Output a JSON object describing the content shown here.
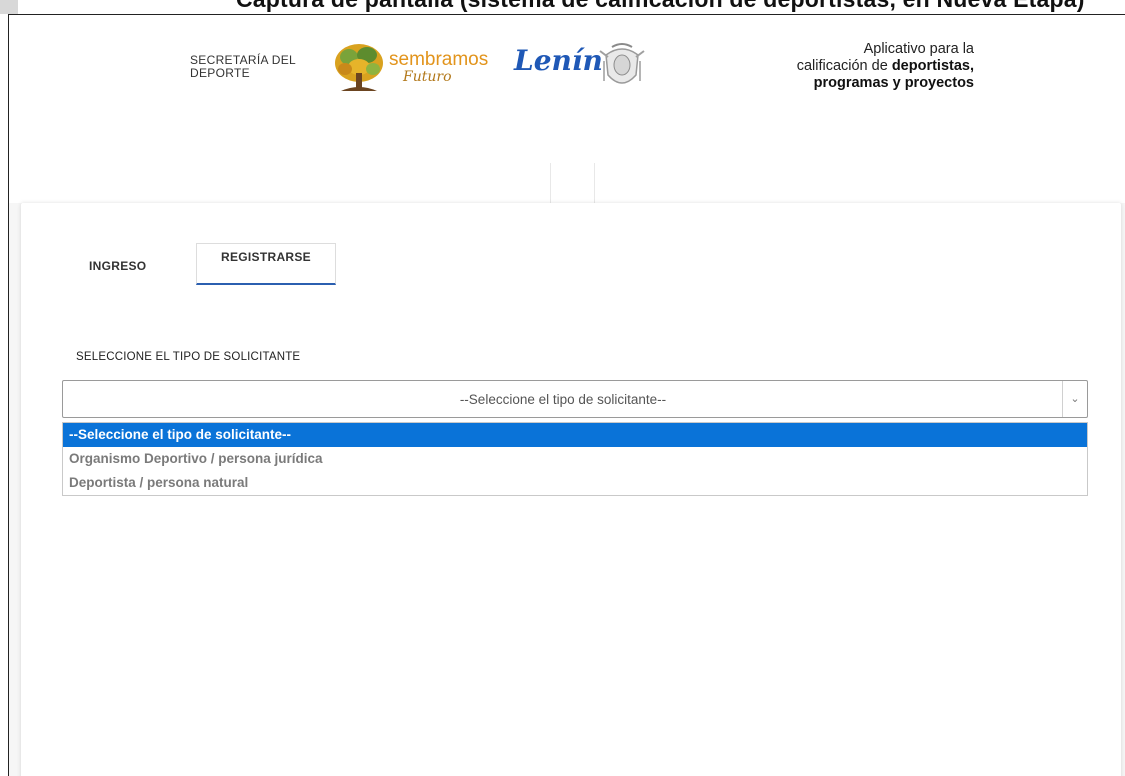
{
  "page_caption": "Captura de pantalla (sistema de calificación de deportistas, en Nueva Etapa)",
  "header": {
    "org_line1": "SECRETARÍA DEL",
    "org_line2": "DEPORTE",
    "slogan_word1": "sembramos",
    "slogan_word2": "Futuro",
    "signature_text": "Lenín",
    "app_title_line1": "Aplicativo para la",
    "app_title_line2_prefix": "calificación de ",
    "app_title_line2_bold": "deportistas,",
    "app_title_line3": "programas y proyectos"
  },
  "tabs": {
    "ingreso": "INGRESO",
    "registrarse": "REGISTRARSE"
  },
  "form": {
    "select_label": "SELECCIONE EL TIPO DE SOLICITANTE",
    "selected_value": "--Seleccione el tipo de solicitante--",
    "options": [
      "--Seleccione el tipo de solicitante--",
      "Organismo Deportivo / persona jurídica",
      "Deportista / persona natural"
    ],
    "highlighted_index": 0
  },
  "colors": {
    "accent_blue": "#0a73d8",
    "tab_underline": "#2b5fb0",
    "logo_orange": "#e2941c",
    "logo_blue": "#1f58b6"
  },
  "icons": [
    "tree-icon",
    "coat-of-arms-icon",
    "chevron-down-icon"
  ]
}
